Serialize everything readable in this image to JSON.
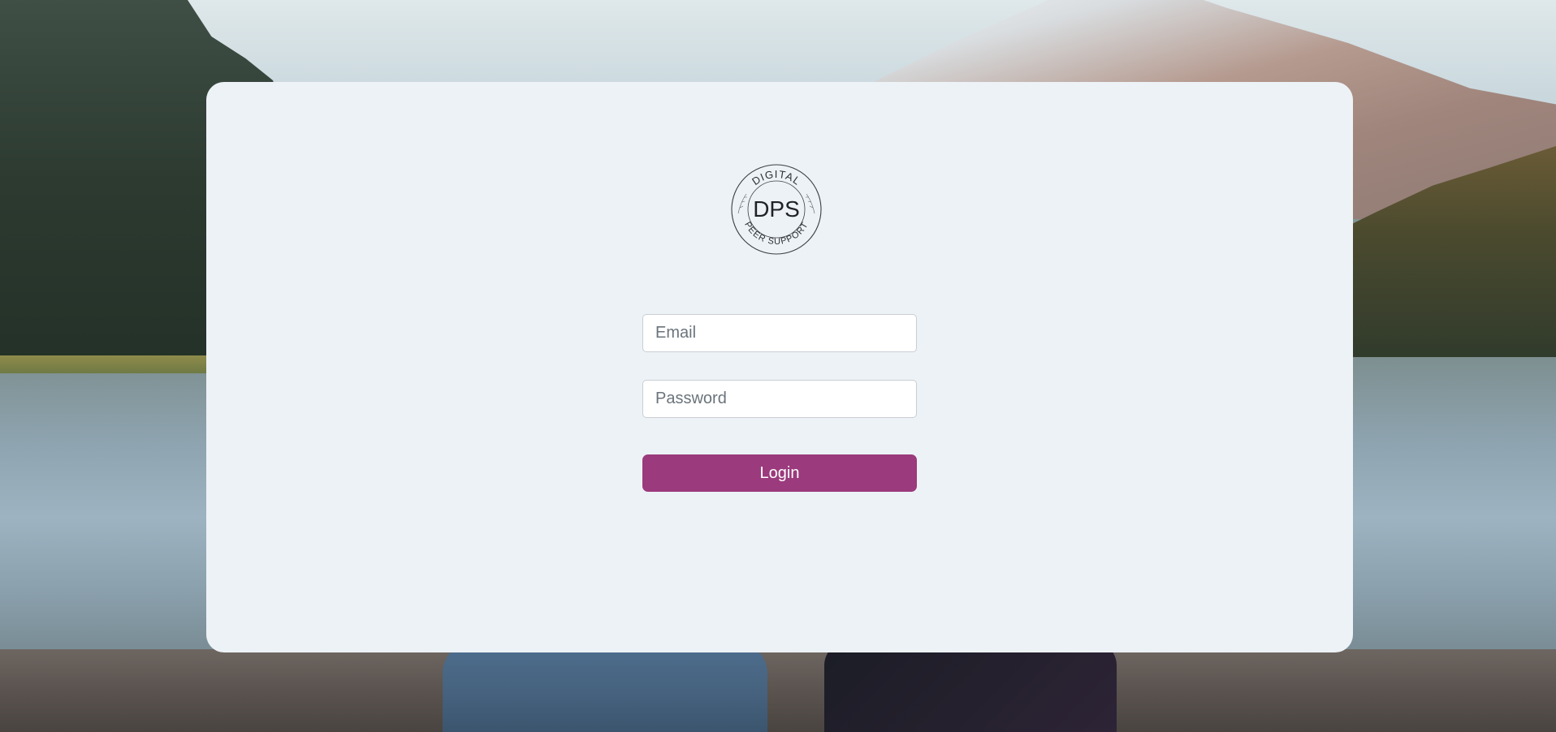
{
  "brand": {
    "logo_top_text": "DIGITAL",
    "logo_center_text": "DPS",
    "logo_bottom_text": "PEER SUPPORT"
  },
  "login_form": {
    "email_placeholder": "Email",
    "password_placeholder": "Password",
    "login_label": "Login"
  },
  "colors": {
    "card_background": "#edf2f6",
    "accent": "#9b3a7c"
  }
}
